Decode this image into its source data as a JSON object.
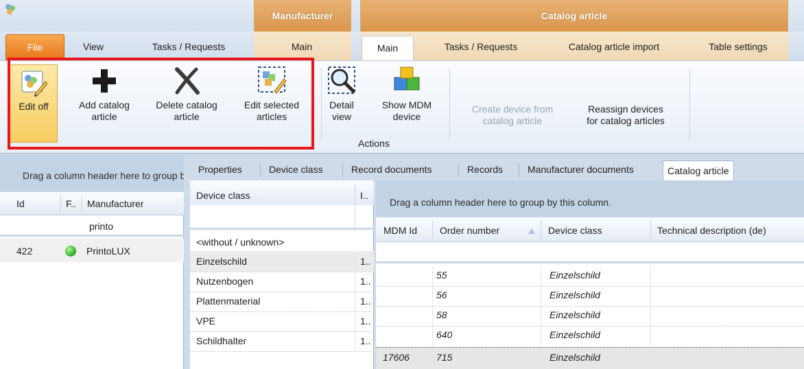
{
  "ribbon": {
    "context_groups": {
      "manufacturer": "Manufacturer",
      "catalog_article": "Catalog article"
    },
    "tabs": {
      "file": "File",
      "view": "View",
      "tasks_requests": "Tasks / Requests",
      "manufacturer_main": "Main",
      "catalog_main": "Main",
      "catalog_tasks_requests": "Tasks / Requests",
      "catalog_article_import": "Catalog article import",
      "table_settings": "Table settings"
    },
    "buttons": {
      "edit_off": "Edit off",
      "add_catalog_article_1": "Add catalog",
      "add_catalog_article_2": "article",
      "delete_catalog_article_1": "Delete catalog",
      "delete_catalog_article_2": "article",
      "edit_selected_1": "Edit selected",
      "edit_selected_2": "articles",
      "detail_view_1": "Detail",
      "detail_view_2": "view",
      "show_mdm_1": "Show MDM",
      "show_mdm_2": "device",
      "create_device_1": "Create device from",
      "create_device_2": "catalog article",
      "reassign_1": "Reassign devices",
      "reassign_2": "for catalog articles"
    },
    "group_label_actions": "Actions"
  },
  "left_grid": {
    "group_hint": "Drag a column header here to group by this column.",
    "headers": {
      "id": "Id",
      "f": "F..",
      "manufacturer": "Manufacturer"
    },
    "filter_manufacturer": "printo",
    "rows": [
      {
        "id": "422",
        "status": "green",
        "manufacturer": "PrintoLUX"
      }
    ]
  },
  "detail_tabs": [
    "Properties",
    "Device class",
    "Record documents",
    "Records",
    "Manufacturer documents",
    "Catalog article"
  ],
  "device_class_grid": {
    "headers": {
      "device_class": "Device class",
      "i": "I.."
    },
    "rows": [
      {
        "name": "<without / unknown>",
        "i": ""
      },
      {
        "name": "Einzelschild",
        "i": "1.."
      },
      {
        "name": "Nutzenbogen",
        "i": "1.."
      },
      {
        "name": "Plattenmaterial",
        "i": "1.."
      },
      {
        "name": "VPE",
        "i": "1.."
      },
      {
        "name": "Schildhalter",
        "i": "1.."
      }
    ]
  },
  "catalog_grid": {
    "group_hint": "Drag a column header here to group by this column.",
    "headers": {
      "mdm_id": "MDM Id",
      "order_number": "Order number",
      "device_class": "Device class",
      "tech_desc": "Technical description (de)"
    },
    "rows": [
      {
        "mdm_id": "",
        "order_number": "55",
        "device_class": "Einzelschild"
      },
      {
        "mdm_id": "",
        "order_number": "56",
        "device_class": "Einzelschild"
      },
      {
        "mdm_id": "",
        "order_number": "58",
        "device_class": "Einzelschild"
      },
      {
        "mdm_id": "",
        "order_number": "640",
        "device_class": "Einzelschild"
      },
      {
        "mdm_id": "17606",
        "order_number": "715",
        "device_class": "Einzelschild"
      }
    ]
  }
}
